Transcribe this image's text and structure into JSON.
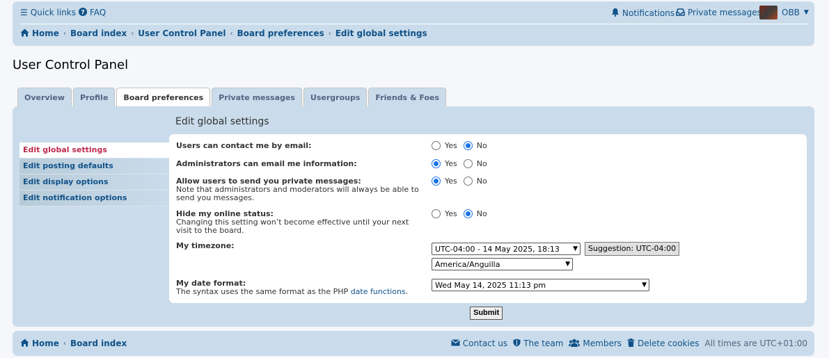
{
  "navbar": {
    "quick_links": "Quick links",
    "faq": "FAQ",
    "notifications": "Notifications",
    "private_messages": "Private messages",
    "username": "OBB",
    "breadcrumbs": [
      "Home",
      "Board index",
      "User Control Panel",
      "Board preferences",
      "Edit global settings"
    ]
  },
  "page_title": "User Control Panel",
  "tabs": [
    {
      "label": "Overview",
      "active": false
    },
    {
      "label": "Profile",
      "active": false
    },
    {
      "label": "Board preferences",
      "active": true
    },
    {
      "label": "Private messages",
      "active": false
    },
    {
      "label": "Usergroups",
      "active": false
    },
    {
      "label": "Friends & Foes",
      "active": false
    }
  ],
  "panel_heading": "Edit global settings",
  "sidemenu": [
    {
      "label": "Edit global settings",
      "active": true
    },
    {
      "label": "Edit posting defaults",
      "active": false
    },
    {
      "label": "Edit display options",
      "active": false
    },
    {
      "label": "Edit notification options",
      "active": false
    }
  ],
  "settings": {
    "contact_email": {
      "label": "Users can contact me by email:",
      "value": "No"
    },
    "admin_email": {
      "label": "Administrators can email me information:",
      "value": "Yes"
    },
    "allow_pm": {
      "label": "Allow users to send you private messages:",
      "explain": "Note that administrators and moderators will always be able to send you messages.",
      "value": "Yes"
    },
    "hide_online": {
      "label": "Hide my online status:",
      "explain": "Changing this setting won’t become effective until your next visit to the board.",
      "value": "No"
    },
    "timezone": {
      "label": "My timezone:",
      "date_value": "UTC-04:00 - 14 May 2025, 18:13",
      "suggestion": "Suggestion: UTC-04:00",
      "zone_value": "America/Anguilla"
    },
    "date_format": {
      "label": "My date format:",
      "explain_prefix": "The syntax uses the same format as the PHP",
      "explain_link": "date functions",
      "explain_suffix": ".",
      "value": "Wed May 14, 2025 11:13 pm"
    },
    "yes": "Yes",
    "no": "No"
  },
  "submit_label": "Submit",
  "footer": {
    "breadcrumbs": [
      "Home",
      "Board index"
    ],
    "contact_us": "Contact us",
    "the_team": "The team",
    "members": "Members",
    "delete_cookies": "Delete cookies",
    "timezone_note": "All times are UTC+01:00"
  },
  "colors": {
    "accent": "#105289",
    "panel_bg": "#cadceb",
    "active_menu_text": "#bc2a4d",
    "radio_selected": "#1a73e8"
  },
  "icons": [
    "hamburger-icon",
    "question-circle-icon",
    "bell-icon",
    "inbox-icon",
    "home-icon",
    "envelope-icon",
    "shield-icon",
    "users-icon",
    "trash-icon"
  ]
}
